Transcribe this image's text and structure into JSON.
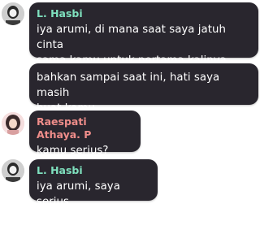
{
  "colors": {
    "bubble_bg": "#29262e",
    "name_green": "#7fe0be",
    "name_pink": "#ef8d8a",
    "text": "#ffffff"
  },
  "messages": [
    {
      "sender": "L. Hasbi",
      "avatar_icon": "user-avatar-bw-photo",
      "text_lines": [
        "iya arumi, di mana saat saya jatuh cinta",
        "sama kamu untuk pertama kalinya"
      ]
    },
    {
      "text_lines": [
        "bahkan sampai saat ini, hati saya masih",
        "buat kamu"
      ]
    },
    {
      "sender": "Raespati Athaya. P",
      "avatar_icon": "user-avatar-photo",
      "text_lines": [
        "kamu serius?"
      ]
    },
    {
      "sender": "L. Hasbi",
      "avatar_icon": "user-avatar-bw-photo",
      "text_lines": [
        "iya arumi, saya serius"
      ]
    }
  ]
}
